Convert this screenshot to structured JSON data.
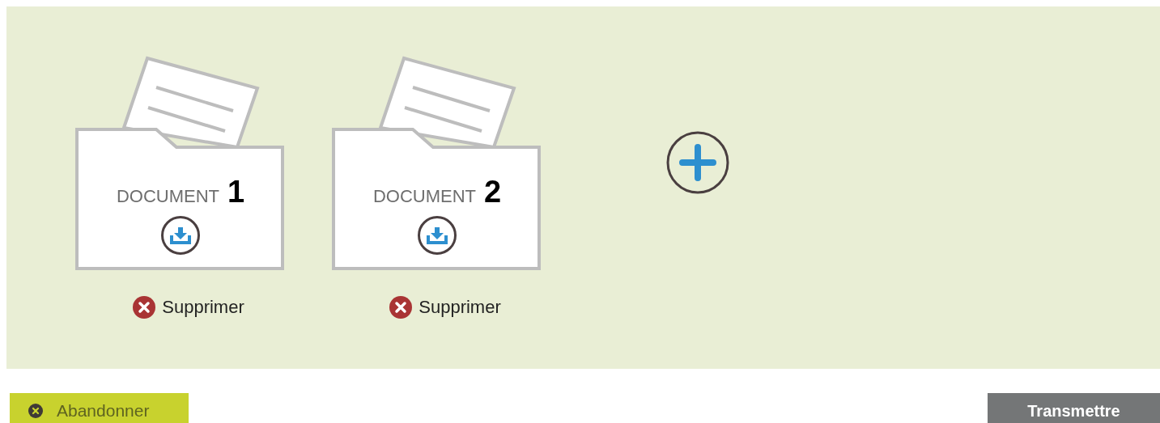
{
  "documents": [
    {
      "label": "DOCUMENT",
      "number": "1",
      "delete": "Supprimer"
    },
    {
      "label": "DOCUMENT",
      "number": "2",
      "delete": "Supprimer"
    }
  ],
  "footer": {
    "cancel": "Abandonner",
    "submit": "Transmettre"
  }
}
